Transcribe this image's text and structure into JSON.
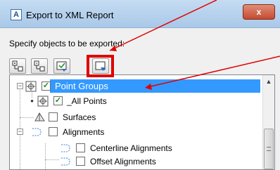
{
  "window": {
    "title": "Export to XML Report",
    "app_icon_letter": "A",
    "close_glyph": "x"
  },
  "prompt": "Specify objects to be exported:",
  "toolbar": {
    "buttons": [
      "expand-tree-icon",
      "collapse-tree-icon",
      "check-all-icon",
      "select-export-icon"
    ]
  },
  "tree": {
    "items": [
      {
        "label": "Point Groups",
        "checked": true,
        "selected": true,
        "expander": "−"
      },
      {
        "label": "_All Points",
        "checked": true,
        "selected": false,
        "expander": "•"
      },
      {
        "label": "Surfaces",
        "checked": false,
        "selected": false,
        "expander": ""
      },
      {
        "label": "Alignments",
        "checked": false,
        "selected": false,
        "expander": "−"
      },
      {
        "label": "Centerline Alignments",
        "checked": false,
        "selected": false,
        "expander": ""
      },
      {
        "label": "Offset Alignments",
        "checked": false,
        "selected": false,
        "expander": ""
      }
    ],
    "check_glyph": "✓",
    "scroll_up_glyph": "▲"
  },
  "colors": {
    "annotation": "#e00000",
    "selection": "#3399ff"
  }
}
